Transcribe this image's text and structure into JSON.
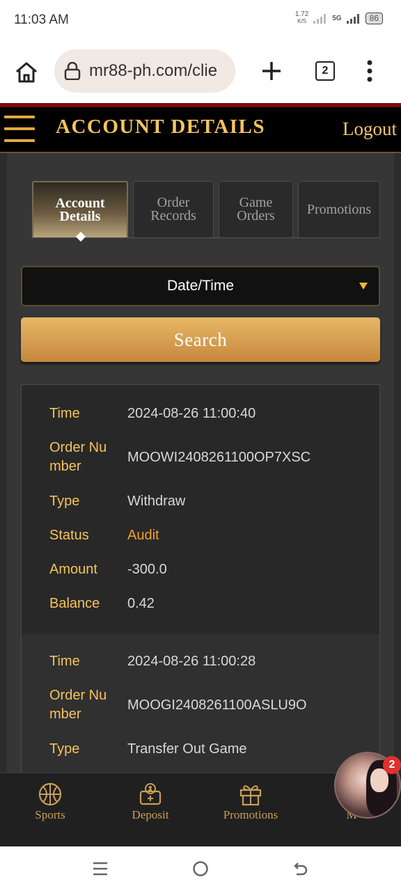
{
  "status_bar": {
    "time": "11:03 AM",
    "net_speed_value": "1.72",
    "net_speed_unit": "K/S",
    "network_type": "5G",
    "battery": "86"
  },
  "browser": {
    "url": "mr88-ph.com/clie",
    "tab_count": "2"
  },
  "header": {
    "title": "ACCOUNT DETAILS",
    "logout": "Logout"
  },
  "tabs": [
    {
      "line1": "Account",
      "line2": "Details",
      "active": true
    },
    {
      "line1": "Order",
      "line2": "Records",
      "active": false
    },
    {
      "line1": "Game",
      "line2": "Orders",
      "active": false
    },
    {
      "line1": "Promotions",
      "line2": "",
      "active": false
    }
  ],
  "filter": {
    "date_select": "Date/Time",
    "search_label": "Search"
  },
  "labels": {
    "time": "Time",
    "order_number_1": "Order Nu",
    "order_number_2": "mber",
    "type": "Type",
    "status": "Status",
    "amount": "Amount",
    "balance": "Balance"
  },
  "records": [
    {
      "time": "2024-08-26 11:00:40",
      "order_number": "MOOWI2408261100OP7XSC",
      "type": "Withdraw",
      "status": "Audit",
      "amount": "-300.0",
      "balance": "0.42"
    },
    {
      "time": "2024-08-26 11:00:28",
      "order_number": "MOOGI2408261100ASLU9O",
      "type": "Transfer Out Game"
    }
  ],
  "bottom_nav": {
    "sports": "Sports",
    "deposit": "Deposit",
    "promotions": "Promotions",
    "more": "M"
  },
  "chat": {
    "badge": "2"
  },
  "colors": {
    "gold": "#f5c45e",
    "label_gold": "#f6c35a",
    "audit": "#f0a030",
    "header_bg": "#000000",
    "panel_bg": "#363636"
  }
}
